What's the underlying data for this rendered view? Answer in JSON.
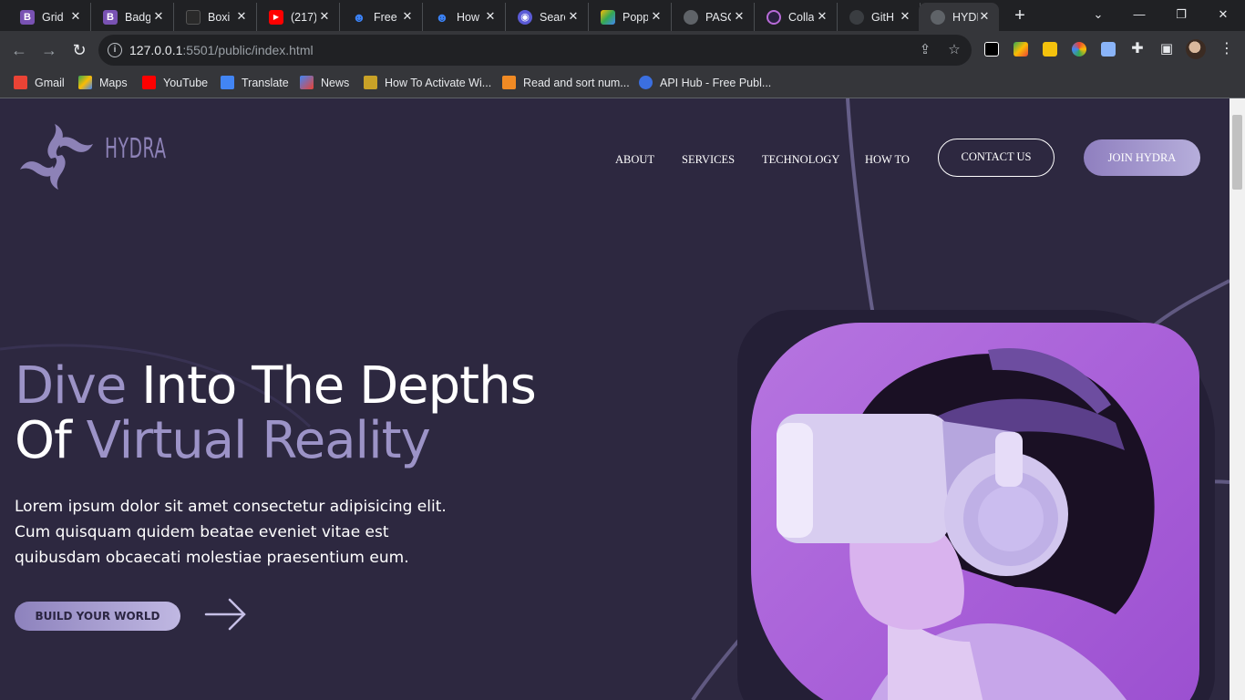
{
  "browser": {
    "tabs": [
      {
        "title": "Grid",
        "favicon": "bootstrap-icon",
        "color": "#7952b3",
        "glyph": "B"
      },
      {
        "title": "Badg",
        "favicon": "bootstrap-icon",
        "color": "#7952b3",
        "glyph": "B"
      },
      {
        "title": "Boxi",
        "favicon": "codepen-icon",
        "color": "#2a2a2a",
        "glyph": ""
      },
      {
        "title": "(217)",
        "favicon": "youtube-icon",
        "color": "#ff0000",
        "glyph": "▶"
      },
      {
        "title": "Free",
        "favicon": "skull-icon",
        "color": "#1f6fd1",
        "glyph": "☻"
      },
      {
        "title": "How",
        "favicon": "skull-icon",
        "color": "#1f6fd1",
        "glyph": "☻"
      },
      {
        "title": "Searc",
        "favicon": "search-app-icon",
        "color": "#5b5bd6",
        "glyph": "◉"
      },
      {
        "title": "Popp",
        "favicon": "google-drive-icon",
        "color": "#2f9e44",
        "glyph": "▲"
      },
      {
        "title": "PASC",
        "favicon": "globe-icon",
        "color": "#5f6368",
        "glyph": "◍"
      },
      {
        "title": "Colla",
        "favicon": "collab-icon",
        "color": "#b86bd8",
        "glyph": "◎"
      },
      {
        "title": "GitH",
        "favicon": "github-icon",
        "color": "#24292e",
        "glyph": "●"
      },
      {
        "title": "HYDI",
        "favicon": "globe-icon",
        "color": "#5f6368",
        "glyph": "◍"
      }
    ],
    "url_host": "127.0.0.1",
    "url_path": ":5501/public/index.html",
    "bookmarks": [
      {
        "label": "Gmail",
        "icon": "gmail-icon",
        "color": "#ea4335"
      },
      {
        "label": "Maps",
        "icon": "maps-icon",
        "color": "#34a853"
      },
      {
        "label": "YouTube",
        "icon": "youtube-icon",
        "color": "#ff0000"
      },
      {
        "label": "Translate",
        "icon": "translate-icon",
        "color": "#4285f4"
      },
      {
        "label": "News",
        "icon": "news-icon",
        "color": "#4285f4"
      },
      {
        "label": "How To Activate Wi...",
        "icon": "page-icon",
        "color": "#c9a227"
      },
      {
        "label": "Read and sort num...",
        "icon": "page-icon",
        "color": "#f08a24"
      },
      {
        "label": "API Hub - Free Publ...",
        "icon": "api-hub-icon",
        "color": "#3b6fe0"
      }
    ]
  },
  "site": {
    "logo_text": "HYDRA",
    "nav": [
      "ABOUT",
      "SERVICES",
      "TECHNOLOGY",
      "HOW TO"
    ],
    "contact_label": "CONTACT US",
    "join_label": "JOIN HYDRA",
    "hero": {
      "title_hl1": "Dive",
      "title_1": " Into The Depths",
      "title_2": "Of ",
      "title_hl2": "Virtual Reality",
      "text": "Lorem ipsum dolor sit amet consectetur adipisicing elit. Cum quisquam quidem beatae eveniet vitae est quibusdam obcaecati molestiae praesentium eum.",
      "cta_label": "BUILD YOUR WORLD"
    },
    "image": "vr-headset-person-photo",
    "colors": {
      "background": "#2d2840",
      "accent": "#9c93c7",
      "photo_bg": "#b06ae0"
    }
  }
}
